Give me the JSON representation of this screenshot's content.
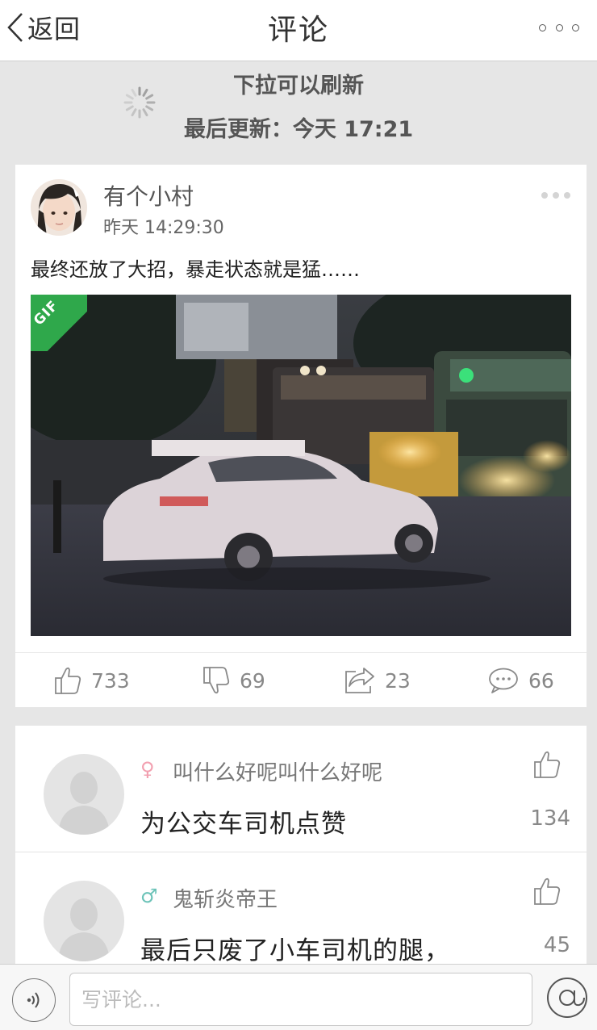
{
  "nav": {
    "back_label": "返回",
    "title": "评论"
  },
  "refresh": {
    "hint": "下拉可以刷新",
    "last_updated": "最后更新：今天 17:21"
  },
  "post": {
    "author": "有个小村",
    "time": "昨天 14:29:30",
    "text": "最终还放了大招，暴走状态就是猛……",
    "media_badge": "GIF",
    "actions": {
      "like_count": "733",
      "dislike_count": "69",
      "share_count": "23",
      "comment_count": "66"
    }
  },
  "comments": [
    {
      "gender": "♀",
      "gender_color": "#f2a0b0",
      "name": "叫什么好呢叫什么好呢",
      "text": "为公交车司机点赞",
      "likes": "134"
    },
    {
      "gender": "♂",
      "gender_color": "#6cc3b8",
      "name": "鬼斩炎帝王",
      "text": "最后只废了小车司机的腿，",
      "likes": "45"
    }
  ],
  "bottom_bar": {
    "input_placeholder": "写评论..."
  },
  "colors": {
    "gif_badge": "#2fa84b",
    "background": "#e6e6e6"
  }
}
